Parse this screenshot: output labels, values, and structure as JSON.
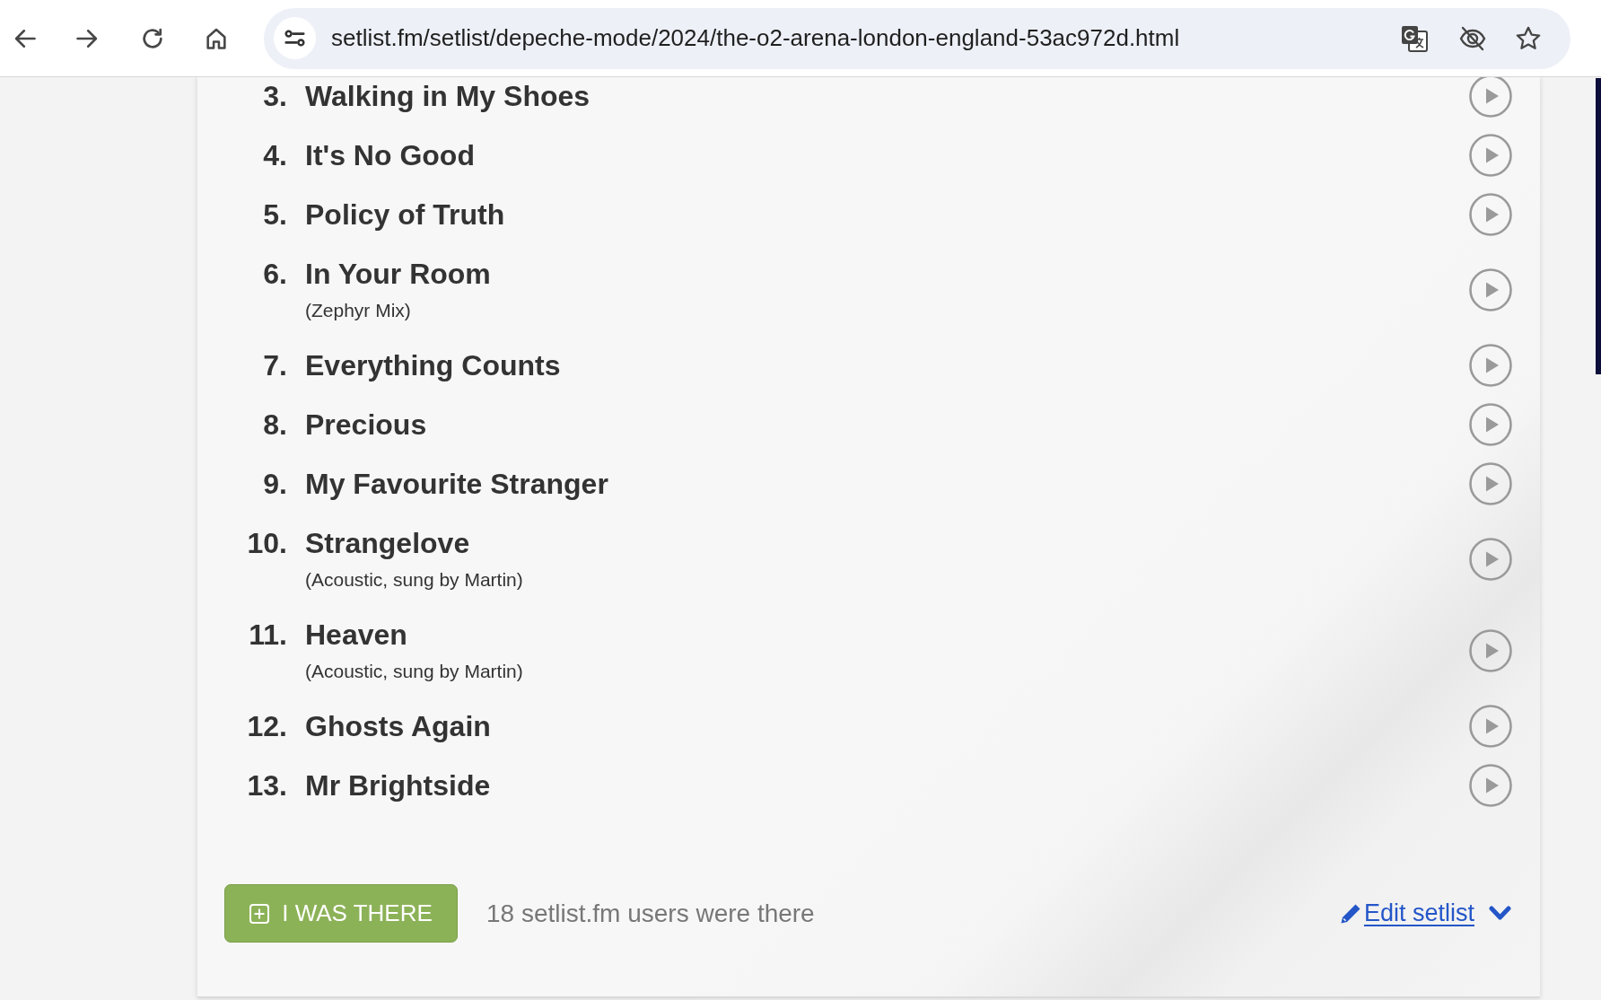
{
  "browser": {
    "url": "setlist.fm/setlist/depeche-mode/2024/the-o2-arena-london-england-53ac972d.html"
  },
  "setlist": {
    "songs": [
      {
        "number": "3.",
        "title": "Walking in My Shoes"
      },
      {
        "number": "4.",
        "title": "It's No Good"
      },
      {
        "number": "5.",
        "title": "Policy of Truth"
      },
      {
        "number": "6.",
        "title": "In Your Room",
        "note": "(Zephyr Mix)"
      },
      {
        "number": "7.",
        "title": "Everything Counts"
      },
      {
        "number": "8.",
        "title": "Precious"
      },
      {
        "number": "9.",
        "title": "My Favourite Stranger"
      },
      {
        "number": "10.",
        "title": "Strangelove",
        "note": "(Acoustic, sung by Martin)"
      },
      {
        "number": "11.",
        "title": "Heaven",
        "note": "(Acoustic, sung by Martin)"
      },
      {
        "number": "12.",
        "title": "Ghosts Again"
      },
      {
        "number": "13.",
        "title": "Mr Brightside"
      }
    ]
  },
  "attendance": {
    "button": "I WAS THERE",
    "count": "18 setlist.fm users were there"
  },
  "edit": {
    "link": "Edit setlist"
  }
}
